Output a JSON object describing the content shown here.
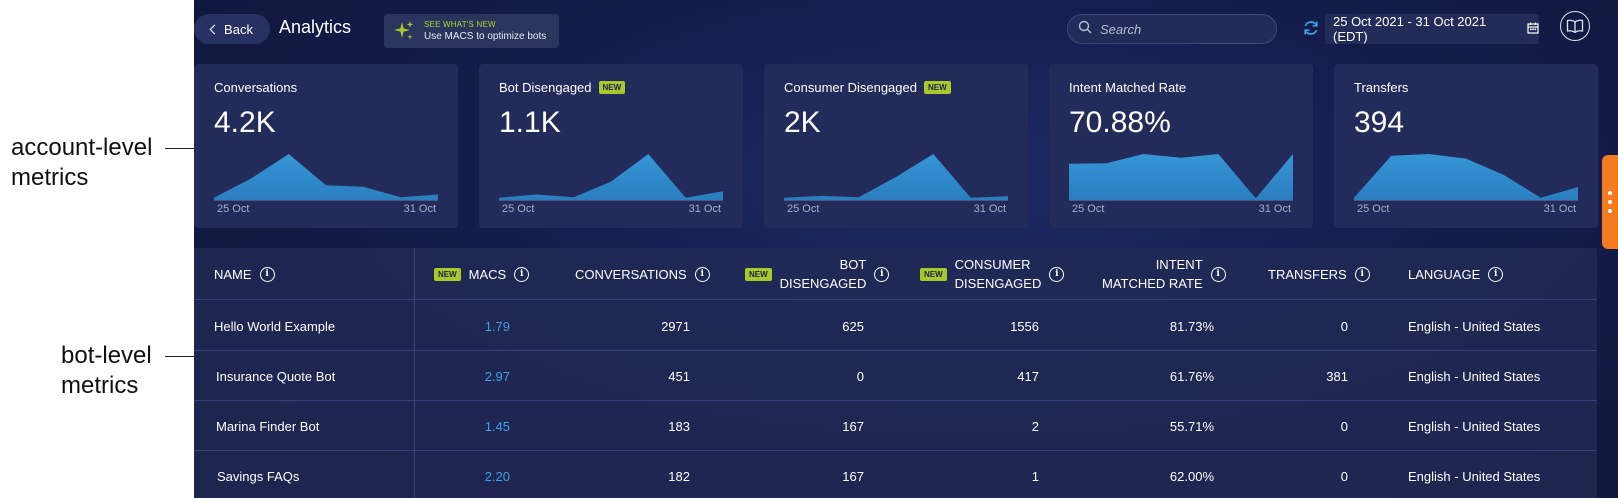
{
  "annotations": {
    "account_level": "account-level\nmetrics",
    "bot_level": "bot-level\nmetrics"
  },
  "header": {
    "back_label": "Back",
    "title": "Analytics",
    "whats_new_tag": "SEE WHAT'S NEW",
    "whats_new_text": "Use MACS to optimize bots",
    "search_placeholder": "Search",
    "date_range": "25 Oct 2021 - 31 Oct 2021 (EDT)"
  },
  "new_badge": "NEW",
  "cards": [
    {
      "title": "Conversations",
      "value": "4.2K",
      "is_new": false,
      "start": "25 Oct",
      "end": "31 Oct",
      "series": [
        0.05,
        0.47,
        1.0,
        0.32,
        0.29,
        0.06,
        0.12
      ]
    },
    {
      "title": "Bot Disengaged",
      "value": "1.1K",
      "is_new": true,
      "start": "25 Oct",
      "end": "31 Oct",
      "series": [
        0.05,
        0.12,
        0.06,
        0.4,
        1.0,
        0.05,
        0.19
      ]
    },
    {
      "title": "Consumer Disengaged",
      "value": "2K",
      "is_new": true,
      "start": "25 Oct",
      "end": "31 Oct",
      "series": [
        0.05,
        0.09,
        0.06,
        0.5,
        1.0,
        0.05,
        0.08
      ]
    },
    {
      "title": "Intent Matched Rate",
      "value": "70.88%",
      "is_new": false,
      "start": "25 Oct",
      "end": "31 Oct",
      "series": [
        0.79,
        0.8,
        1.0,
        0.92,
        1.0,
        0.04,
        1.0
      ]
    },
    {
      "title": "Transfers",
      "value": "394",
      "is_new": false,
      "start": "25 Oct",
      "end": "31 Oct",
      "series": [
        0.05,
        0.96,
        1.0,
        0.9,
        0.55,
        0.05,
        0.28
      ]
    }
  ],
  "table": {
    "columns": [
      {
        "label": "NAME",
        "is_new": false
      },
      {
        "label": "MACS",
        "is_new": true
      },
      {
        "label": "CONVERSATIONS",
        "is_new": false
      },
      {
        "label": "BOT\nDISENGAGED",
        "is_new": true
      },
      {
        "label": "CONSUMER\nDISENGAGED",
        "is_new": true
      },
      {
        "label": "INTENT\nMATCHED RATE",
        "is_new": false
      },
      {
        "label": "TRANSFERS",
        "is_new": false
      },
      {
        "label": "LANGUAGE",
        "is_new": false
      }
    ],
    "rows": [
      {
        "name": "Hello World Example",
        "macs": "1.79",
        "conversations": "2971",
        "bot_disengaged": "625",
        "consumer_disengaged": "1556",
        "intent_matched_rate": "81.73%",
        "transfers": "0",
        "language": "English - United States"
      },
      {
        "name": "Insurance Quote Bot",
        "macs": "2.97",
        "conversations": "451",
        "bot_disengaged": "0",
        "consumer_disengaged": "417",
        "intent_matched_rate": "61.76%",
        "transfers": "381",
        "language": "English - United States"
      },
      {
        "name": "Marina Finder Bot",
        "macs": "1.45",
        "conversations": "183",
        "bot_disengaged": "167",
        "consumer_disengaged": "2",
        "intent_matched_rate": "55.71%",
        "transfers": "0",
        "language": "English - United States"
      },
      {
        "name": "Savings FAQs",
        "macs": "2.20",
        "conversations": "182",
        "bot_disengaged": "167",
        "consumer_disengaged": "1",
        "intent_matched_rate": "62.00%",
        "transfers": "0",
        "language": "English - United States"
      }
    ]
  },
  "colors": {
    "accent": "#3ba2e6",
    "new_badge": "#a8c92c",
    "side_tab": "#f47b20",
    "sparkline_fill": "#2a7ec0"
  }
}
